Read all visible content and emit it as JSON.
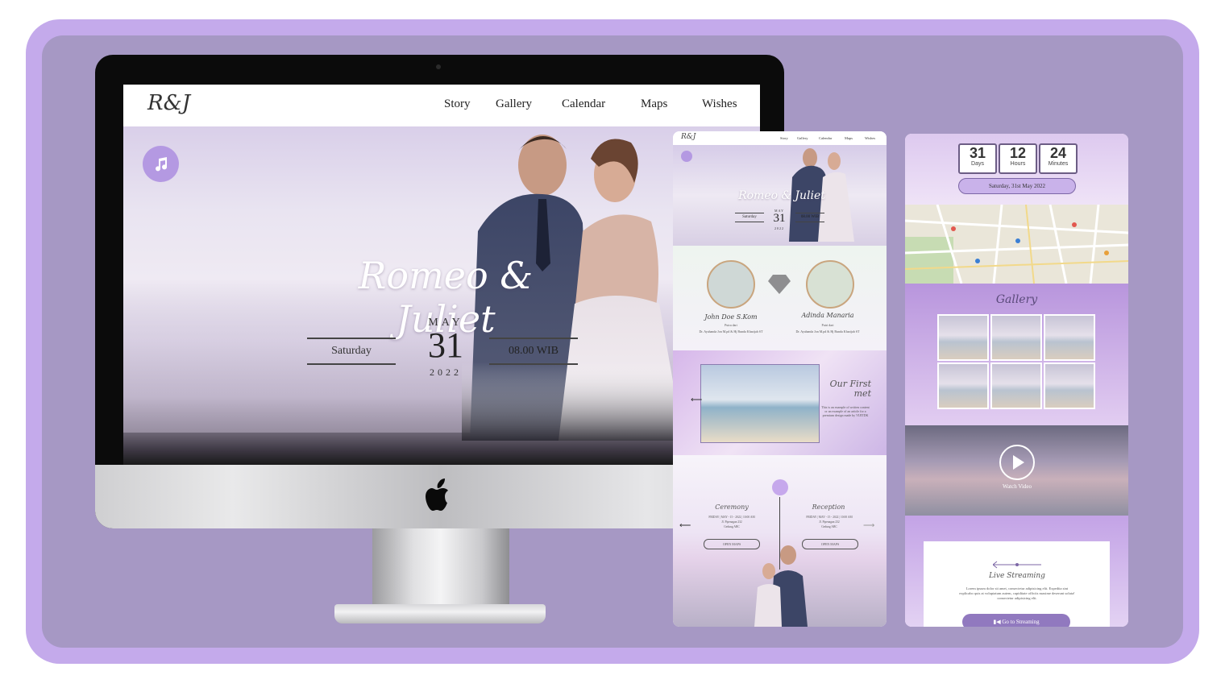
{
  "desktop": {
    "logo": "R&J",
    "nav": [
      "Story",
      "Gallery",
      "Calendar",
      "Maps",
      "Wishes"
    ],
    "hero_title": "Romeo & Juliet",
    "day": "Saturday",
    "month": "MAY",
    "date": "31",
    "year": "2022",
    "time": "08.00 WIB"
  },
  "mobile1": {
    "logo": "R&J",
    "nav": [
      "Story",
      "Gallery",
      "Calendar",
      "Maps",
      "Wishes"
    ],
    "hero_title": "Romeo & Juliet",
    "day": "Saturday",
    "month": "MAY",
    "date": "31",
    "year": "2022",
    "time": "08.00 WIB",
    "groom_name": "John Doe S.Kom",
    "groom_role": "Putra dari",
    "groom_parents": "Dr. Ayahanda Jon M.pd & Hj Bunda Kharijah ST",
    "bride_name": "Adinda Manaria",
    "bride_role": "Putri dari",
    "bride_parents": "Dr. Ayahanda Jon M.pd & Hj Bunda Kharijah ST",
    "story_title": "Our First met",
    "story_text": "This is an example of written content or an example of an article for a premium design made by VIJITDK",
    "ceremony_title": "Ceremony",
    "ceremony_date": "FRIDAY | MAY - 15 - 2022 | 10:00 AM",
    "ceremony_place": "Jl. Pipenagan 232",
    "ceremony_city": "Gedung ABC",
    "ceremony_btn": "OPEN MAPS",
    "reception_title": "Reception",
    "reception_date": "FRIDAY | MAY - 15 - 2022 | 10:00 AM",
    "reception_place": "Jl. Pipenagan 232",
    "reception_city": "Gedung ABC",
    "reception_btn": "OPEN MAPS"
  },
  "mobile2": {
    "days": "31",
    "days_label": "Days",
    "hours": "12",
    "hours_label": "Hours",
    "minutes": "24",
    "minutes_label": "Minutes",
    "date_pill": "Saturday, 31st May 2022",
    "gallery_title": "Gallery",
    "video_label": "Watch Video",
    "stream_title": "Live Streaming",
    "stream_text": "Lorem ipsum dolor sit amet, consectetur adipisicing elit. Expedita sint explicabo quis at voluptatum autem, cupiditate officiis maxime deserunt soluta! consectetur adipisicing elit.",
    "stream_btn": "Go to Streaming"
  },
  "colors": {
    "frame": "#c4aaeb",
    "background": "#a698c4",
    "accent": "#b499e2",
    "button": "#9179bf"
  }
}
